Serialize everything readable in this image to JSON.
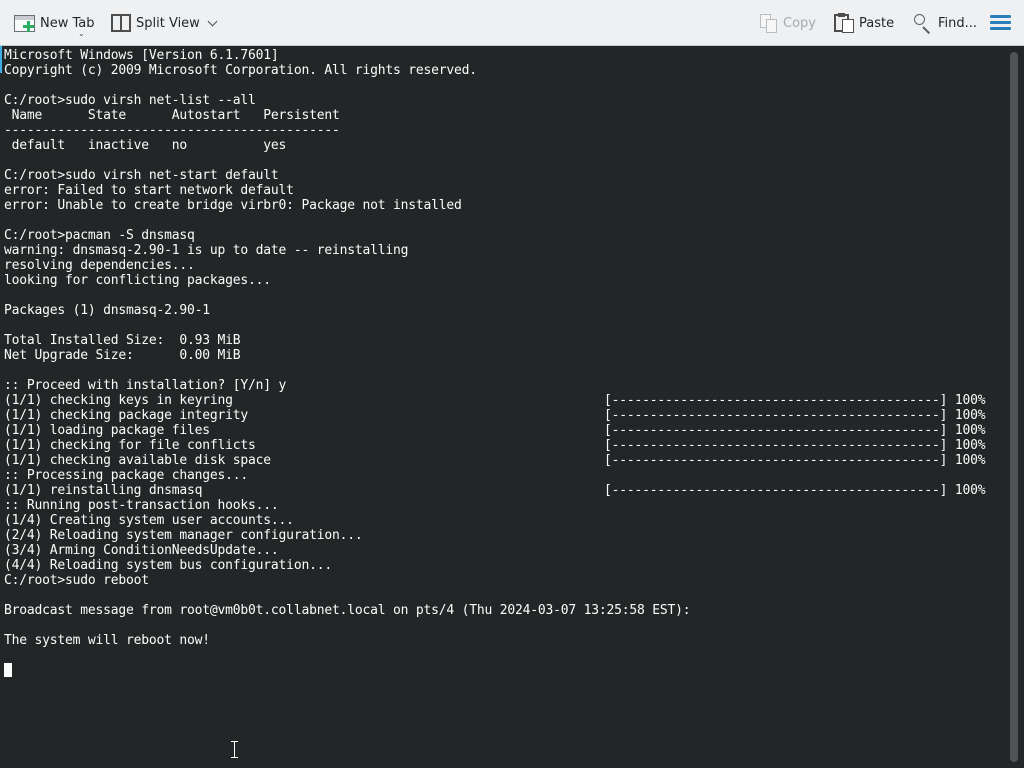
{
  "toolbar": {
    "new_tab": {
      "label": "New Tab",
      "icon": "new-tab-icon",
      "has_menu": true
    },
    "split_view": {
      "label": "Split View",
      "icon": "split-view-icon"
    },
    "copy": {
      "label": "Copy",
      "icon": "copy-icon",
      "enabled": false
    },
    "paste": {
      "label": "Paste",
      "icon": "paste-icon"
    },
    "find": {
      "label": "Find...",
      "icon": "find-icon"
    },
    "menu": {
      "icon": "hamburger-menu-icon",
      "color": "#2980b9"
    }
  },
  "colors": {
    "terminal_bg": "#232627",
    "terminal_fg": "#fcfcfc",
    "toolbar_bg": "#eff0f1",
    "accent": "#3daee9"
  },
  "terminal": {
    "lines": [
      {
        "text": "Microsoft Windows [Version 6.1.7601]"
      },
      {
        "text": "Copyright (c) 2009 Microsoft Corporation. All rights reserved."
      },
      {
        "text": ""
      },
      {
        "text": "C:/root>sudo virsh net-list --all"
      },
      {
        "text": " Name      State      Autostart   Persistent"
      },
      {
        "text": "--------------------------------------------"
      },
      {
        "text": " default   inactive   no          yes"
      },
      {
        "text": ""
      },
      {
        "text": "C:/root>sudo virsh net-start default"
      },
      {
        "text": "error: Failed to start network default"
      },
      {
        "text": "error: Unable to create bridge virbr0: Package not installed"
      },
      {
        "text": ""
      },
      {
        "text": "C:/root>pacman -S dnsmasq"
      },
      {
        "text": "warning: dnsmasq-2.90-1 is up to date -- reinstalling"
      },
      {
        "text": "resolving dependencies..."
      },
      {
        "text": "looking for conflicting packages..."
      },
      {
        "text": ""
      },
      {
        "text": "Packages (1) dnsmasq-2.90-1"
      },
      {
        "text": ""
      },
      {
        "text": "Total Installed Size:  0.93 MiB"
      },
      {
        "text": "Net Upgrade Size:      0.00 MiB"
      },
      {
        "text": ""
      },
      {
        "text": ":: Proceed with installation? [Y/n] y"
      },
      {
        "text": "(1/1) checking keys in keyring",
        "progress": "[-------------------------------------------] 100%"
      },
      {
        "text": "(1/1) checking package integrity",
        "progress": "[-------------------------------------------] 100%"
      },
      {
        "text": "(1/1) loading package files",
        "progress": "[-------------------------------------------] 100%"
      },
      {
        "text": "(1/1) checking for file conflicts",
        "progress": "[-------------------------------------------] 100%"
      },
      {
        "text": "(1/1) checking available disk space",
        "progress": "[-------------------------------------------] 100%"
      },
      {
        "text": ":: Processing package changes..."
      },
      {
        "text": "(1/1) reinstalling dnsmasq",
        "progress": "[-------------------------------------------] 100%"
      },
      {
        "text": ":: Running post-transaction hooks..."
      },
      {
        "text": "(1/4) Creating system user accounts..."
      },
      {
        "text": "(2/4) Reloading system manager configuration..."
      },
      {
        "text": "(3/4) Arming ConditionNeedsUpdate..."
      },
      {
        "text": "(4/4) Reloading system bus configuration..."
      },
      {
        "text": "C:/root>sudo reboot"
      },
      {
        "text": ""
      },
      {
        "text": "Broadcast message from root@vm0b0t.collabnet.local on pts/4 (Thu 2024-03-07 13:25:58 EST):"
      },
      {
        "text": ""
      },
      {
        "text": "The system will reboot now!"
      }
    ]
  }
}
